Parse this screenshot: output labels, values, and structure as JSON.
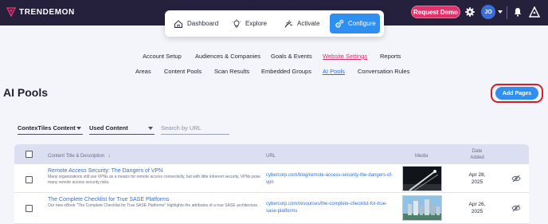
{
  "brand": {
    "name": "TRENDEMON",
    "accent": "#e0326b",
    "primary": "#2f8ff0"
  },
  "topbar": {
    "request_demo": "Request Demo",
    "avatar_initials": "JO"
  },
  "main_nav": [
    {
      "label": "Dashboard",
      "icon": "home-icon"
    },
    {
      "label": "Explore",
      "icon": "explore-icon"
    },
    {
      "label": "Activate",
      "icon": "activate-icon"
    },
    {
      "label": "Configure",
      "icon": "configure-icon",
      "active": true
    }
  ],
  "sub_nav_row1": [
    "Account Setup",
    "Audiences & Companies",
    "Goals & Events",
    "Website Settings",
    "Reports"
  ],
  "sub_nav_row2": [
    "Areas",
    "Content Pools",
    "Scan Results",
    "Embedded Groups",
    "AI Pools",
    "Conversation Rules"
  ],
  "page": {
    "title": "AI Pools",
    "add_button": "Add Pages"
  },
  "filters": {
    "content_type": "ContexTiles Content",
    "usage": "Used Content",
    "search_placeholder": "Search by URL"
  },
  "table": {
    "headers": {
      "title": "Content Title & Description",
      "url": "URL",
      "media": "Media",
      "date": "Date Added"
    },
    "rows": [
      {
        "title": "Remote Access Security: The Dangers of VPN",
        "description": "Many organizations still use VPNs as a means for remote access connectivity, but with little inherent security, VPNs pose many remote access security risks.",
        "url": "cybercorp.com/blog/remote-access-security-the-dangers-of-vpn",
        "date_line1": "Apr 28,",
        "date_line2": "2025"
      },
      {
        "title": "The Complete Checklist for True SASE Platforms",
        "description": "Our new eBook \"The Complete Checklist for True SASE Platforms\" highlights the attributes of a true SASE architecture.",
        "url": "cybercorp.com/resources/the-complete-checklist-for-true-sase-platforms",
        "date_line1": "Apr 26,",
        "date_line2": "2025"
      }
    ]
  }
}
